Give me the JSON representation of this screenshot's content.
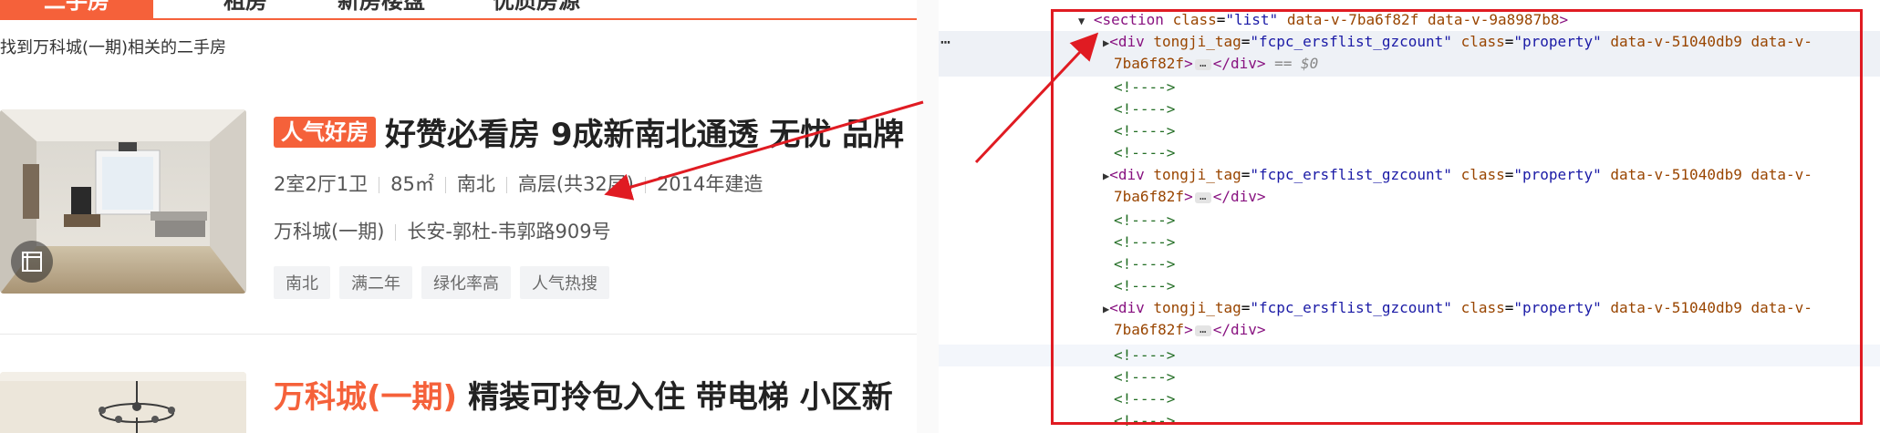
{
  "page": {
    "tabs": [
      {
        "label": "二手房",
        "active": true
      },
      {
        "label": "租房",
        "active": false
      },
      {
        "label": "新房楼盘",
        "active": false
      },
      {
        "label": "优质房源",
        "active": false
      }
    ],
    "found_text": "找到万科城(一期)相关的二手房",
    "listings": [
      {
        "badge": "人气好房",
        "title": "好赞必看房 9成新南北通透 无忧 品牌",
        "layout": "2室2厅1卫",
        "area": "85㎡",
        "orientation": "南北",
        "floor": "高层(共32层)",
        "year": "2014年建造",
        "community": "万科城(一期)",
        "location": "长安-郭杜-韦郭路909号",
        "tags": [
          "南北",
          "满二年",
          "绿化率高",
          "人气热搜"
        ]
      },
      {
        "accent_title": "万科城(一期)",
        "title": "精装可拎包入住 带电梯 小区新"
      }
    ]
  },
  "devtools": {
    "lines": [
      {
        "type": "section",
        "text_tag": "<section",
        "attr1": "class",
        "val1": "\"list\"",
        "attr2": "data-v-7ba6f82f",
        "attr3": "data-v-9a8987b8",
        "close": ">"
      },
      {
        "type": "div-selected",
        "tag": "<div",
        "a1": "tongji_tag",
        "v1": "\"fcpc_ersflist_gzcount\"",
        "a2": "class",
        "v2": "\"property\"",
        "a3": "data-v-51040db9",
        "a4": "data-v-",
        "cont": "7ba6f82f",
        "end": "</div>",
        "eq": "== $0"
      },
      {
        "type": "comment",
        "text": "<!---->"
      },
      {
        "type": "div",
        "tag": "<div",
        "a1": "tongji_tag",
        "v1": "\"fcpc_ersflist_gzcount\"",
        "a2": "class",
        "v2": "\"property\"",
        "a3": "data-v-51040db9",
        "a4": "data-v-",
        "cont": "7ba6f82f",
        "end": "</div>"
      }
    ],
    "ellipsis": "…",
    "row_dots": "⋯"
  },
  "colors": {
    "brand": "#f5613a",
    "annotation_red": "#e01b22"
  },
  "icons": [
    "vr-3d-icon",
    "expand-triangle-icon",
    "collapse-triangle-icon",
    "ellipsis-icon",
    "arrow-annotation"
  ]
}
